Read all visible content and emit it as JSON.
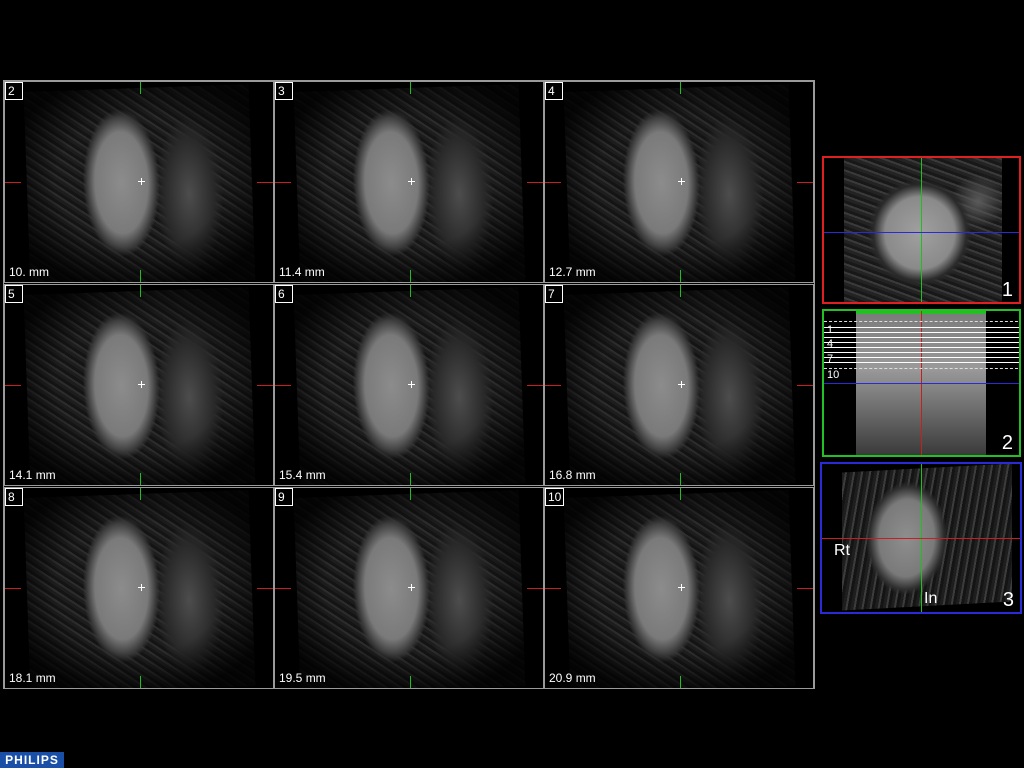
{
  "slices": [
    {
      "number": "2",
      "depth": "10. mm"
    },
    {
      "number": "3",
      "depth": "11.4 mm"
    },
    {
      "number": "4",
      "depth": "12.7 mm"
    },
    {
      "number": "5",
      "depth": "14.1 mm"
    },
    {
      "number": "6",
      "depth": "15.4 mm"
    },
    {
      "number": "7",
      "depth": "16.8 mm"
    },
    {
      "number": "8",
      "depth": "18.1 mm"
    },
    {
      "number": "9",
      "depth": "19.5 mm"
    },
    {
      "number": "10",
      "depth": "20.9 mm"
    }
  ],
  "reference_views": {
    "view1": {
      "index": "1",
      "frame_color": "#e02020"
    },
    "view2": {
      "index": "2",
      "frame_color": "#22c022",
      "slice_marks": [
        "1",
        "4",
        "7",
        "10"
      ]
    },
    "view3": {
      "index": "3",
      "frame_color": "#2a2ad8",
      "orientation_left": "Rt",
      "orientation_bottom": "In"
    }
  },
  "colors": {
    "crosshair_vertical": "#1fbf1f",
    "crosshair_horizontal": "#c81e1e",
    "axis_blue": "#2a2ad8"
  },
  "brand": {
    "logo_text": "PHILIPS"
  }
}
